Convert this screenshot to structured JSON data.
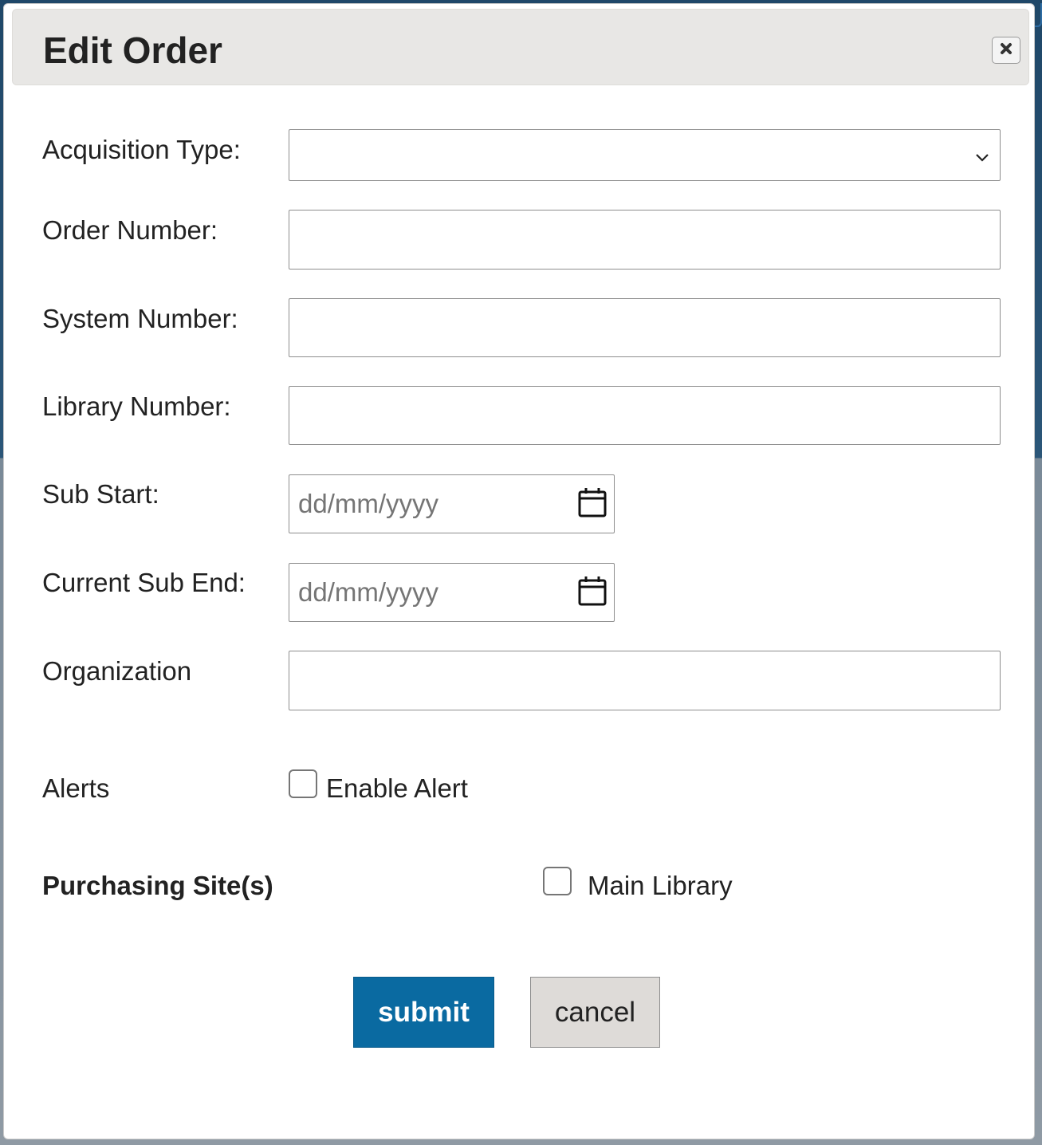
{
  "dialog": {
    "title": "Edit Order",
    "close_icon": "close-icon"
  },
  "form": {
    "acquisition_type": {
      "label": "Acquisition Type:",
      "value": "",
      "icon": "chevron-down-icon"
    },
    "order_number": {
      "label": "Order Number:",
      "value": ""
    },
    "system_number": {
      "label": "System Number:",
      "value": ""
    },
    "library_number": {
      "label": "Library Number:",
      "value": ""
    },
    "sub_start": {
      "label": "Sub Start:",
      "placeholder": "dd/mm/yyyy",
      "icon": "calendar-icon"
    },
    "current_sub_end": {
      "label": "Current Sub End:",
      "placeholder": "dd/mm/yyyy",
      "icon": "calendar-icon"
    },
    "organization": {
      "label": "Organization",
      "value": ""
    },
    "alerts": {
      "label": "Alerts",
      "checkbox_label": "Enable Alert",
      "checked": false
    },
    "purchasing_sites": {
      "label": "Purchasing Site(s)",
      "checkbox_label": "Main Library",
      "checked": false
    }
  },
  "buttons": {
    "submit": "submit",
    "cancel": "cancel"
  },
  "colors": {
    "submit_bg": "#0a6aa1",
    "cancel_bg": "#dedbd8",
    "header_bg": "#e8e7e5"
  }
}
